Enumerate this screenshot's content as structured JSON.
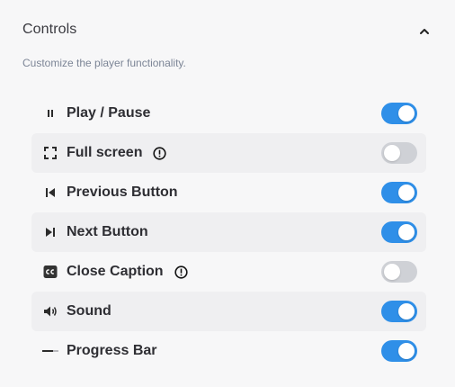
{
  "header": {
    "title": "Controls",
    "collapse_icon": "chevron-up-icon"
  },
  "subtitle": "Customize the player functionality.",
  "colors": {
    "toggle_on": "#2f8fe8",
    "toggle_off": "#cfd1d6"
  },
  "controls": [
    {
      "label": "Play / Pause",
      "icon": "pause-icon",
      "enabled": true,
      "info": false
    },
    {
      "label": "Full screen",
      "icon": "fullscreen-icon",
      "enabled": false,
      "info": true
    },
    {
      "label": "Previous Button",
      "icon": "skip-previous-icon",
      "enabled": true,
      "info": false
    },
    {
      "label": "Next Button",
      "icon": "skip-next-icon",
      "enabled": true,
      "info": false
    },
    {
      "label": "Close Caption",
      "icon": "closed-caption-icon",
      "enabled": false,
      "info": true
    },
    {
      "label": "Sound",
      "icon": "volume-icon",
      "enabled": true,
      "info": false
    },
    {
      "label": "Progress Bar",
      "icon": "progress-bar-icon",
      "enabled": true,
      "info": false
    }
  ]
}
